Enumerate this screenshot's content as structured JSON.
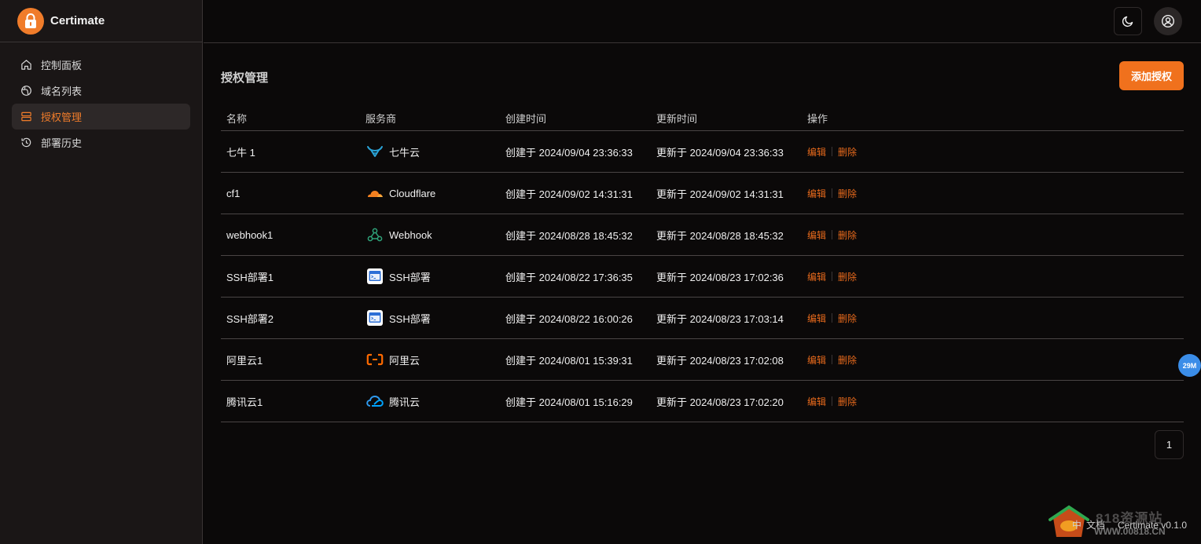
{
  "app": {
    "name": "Certimate"
  },
  "sidebar": {
    "items": [
      {
        "label": "控制面板",
        "icon": "home-icon"
      },
      {
        "label": "域名列表",
        "icon": "globe-icon"
      },
      {
        "label": "授权管理",
        "icon": "server-icon",
        "active": true
      },
      {
        "label": "部署历史",
        "icon": "history-icon"
      }
    ]
  },
  "header": {
    "theme_icon": "moon-icon",
    "user_icon": "user-circle-icon"
  },
  "main": {
    "title": "授权管理",
    "add_button": "添加授权",
    "columns": [
      "名称",
      "服务商",
      "创建时间",
      "更新时间",
      "操作"
    ],
    "rows": [
      {
        "name": "七牛 1",
        "provider": "七牛云",
        "provider_icon": "qiniu-icon",
        "created": "创建于 2024/09/04 23:36:33",
        "updated": "更新于 2024/09/04 23:36:33"
      },
      {
        "name": "cf1",
        "provider": "Cloudflare",
        "provider_icon": "cloudflare-icon",
        "created": "创建于 2024/09/02 14:31:31",
        "updated": "更新于 2024/09/02 14:31:31"
      },
      {
        "name": "webhook1",
        "provider": "Webhook",
        "provider_icon": "webhook-icon",
        "created": "创建于 2024/08/28 18:45:32",
        "updated": "更新于 2024/08/28 18:45:32"
      },
      {
        "name": "SSH部署1",
        "provider": "SSH部署",
        "provider_icon": "ssh-icon",
        "created": "创建于 2024/08/22 17:36:35",
        "updated": "更新于 2024/08/23 17:02:36"
      },
      {
        "name": "SSH部署2",
        "provider": "SSH部署",
        "provider_icon": "ssh-icon",
        "created": "创建于 2024/08/22 16:00:26",
        "updated": "更新于 2024/08/23 17:03:14"
      },
      {
        "name": "阿里云1",
        "provider": "阿里云",
        "provider_icon": "aliyun-icon",
        "created": "创建于 2024/08/01 15:39:31",
        "updated": "更新于 2024/08/23 17:02:08"
      },
      {
        "name": "腾讯云1",
        "provider": "腾讯云",
        "provider_icon": "tencent-cloud-icon",
        "created": "创建于 2024/08/01 15:16:29",
        "updated": "更新于 2024/08/23 17:02:20"
      }
    ],
    "actions": {
      "edit": "编辑",
      "delete": "删除"
    },
    "pagination": {
      "current": "1"
    }
  },
  "badge": {
    "memory": "29M"
  },
  "footer": {
    "lang": "中",
    "docs": "文档",
    "version": "Certimate v0.1.0"
  },
  "watermark": {
    "line1": "818资源站",
    "line2": "WWW.00818.CN"
  },
  "colors": {
    "accent": "#f0711d",
    "bg": "#0b0909",
    "sidebar": "#1a1616"
  }
}
